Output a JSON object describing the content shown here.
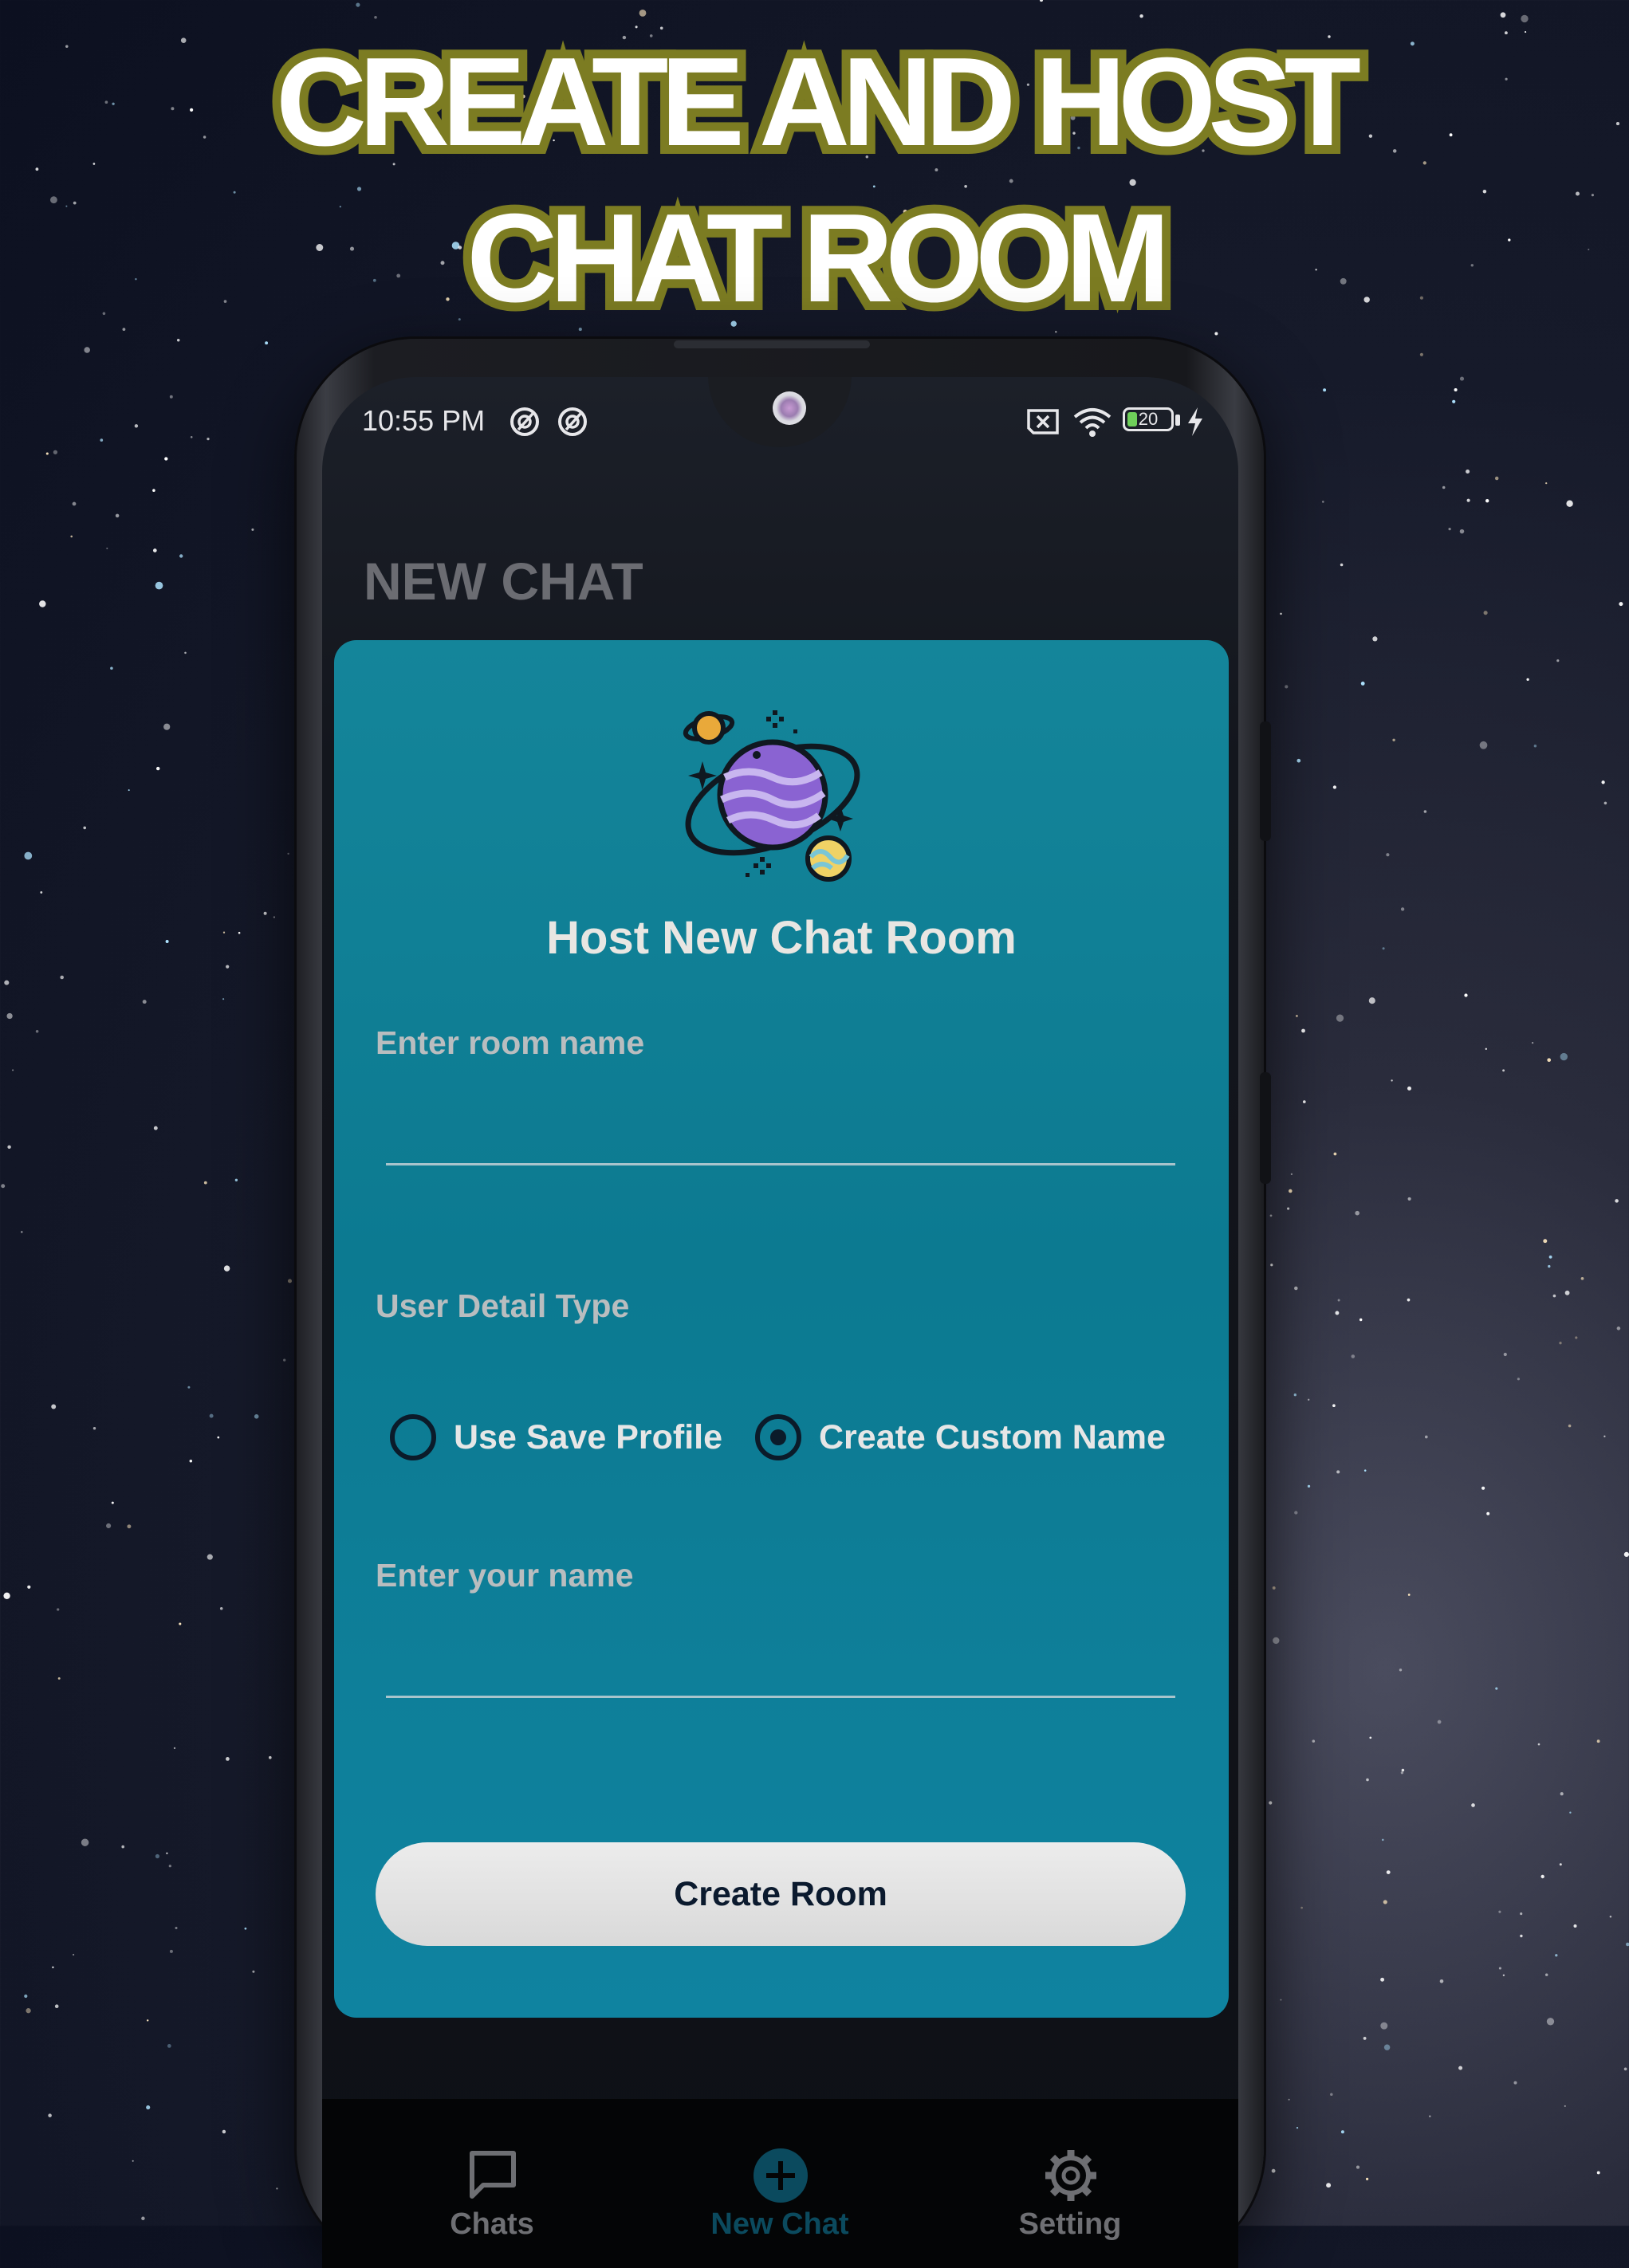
{
  "headline": {
    "line1": "CREATE AND HOST",
    "line2": "CHAT ROOM"
  },
  "status_bar": {
    "time": "10:55 PM",
    "battery": "20"
  },
  "page_title": "NEW CHAT",
  "card": {
    "title": "Host New Chat Room",
    "room_name": {
      "label": "Enter room name",
      "value": ""
    },
    "user_detail": {
      "label": "User Detail Type",
      "options": [
        "Use Save Profile",
        "Create Custom Name"
      ],
      "selected": "Create Custom Name"
    },
    "your_name": {
      "label": "Enter your name",
      "value": ""
    },
    "create_button": "Create Room"
  },
  "bottom_nav": {
    "items": [
      {
        "label": "Chats",
        "icon": "chat-bubble-icon",
        "active": false
      },
      {
        "label": "New Chat",
        "icon": "plus-circle-icon",
        "active": true
      },
      {
        "label": "Setting",
        "icon": "gear-icon",
        "active": false
      }
    ]
  },
  "colors": {
    "headline_outline": "#7c7c22",
    "card_teal": "#0c7a91",
    "nav_active": "#0b4a5e",
    "nav_inactive": "#6e6f73",
    "button_bg": "#e2e2e2"
  }
}
